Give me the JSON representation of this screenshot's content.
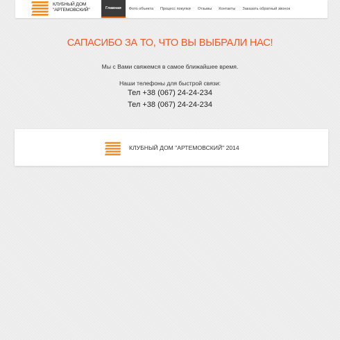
{
  "header": {
    "logo_line1": "КЛУБНЫЙ ДОМ",
    "logo_line2": "\"АРТЕМОВСКИЙ\"",
    "nav": [
      {
        "label": "Главная",
        "active": true
      },
      {
        "label": "Фото объекта",
        "active": false
      },
      {
        "label": "Процесс покупки",
        "active": false
      },
      {
        "label": "Отзывы",
        "active": false
      },
      {
        "label": "Контакты",
        "active": false
      },
      {
        "label": "Заказать обратный звонок",
        "active": false
      }
    ]
  },
  "main": {
    "title": "САПАСИБО ЗА ТО, ЧТО ВЫ ВЫБРАЛИ НАС!",
    "contact_message": "Мы с Вами свяжемся в самое ближайшее время.",
    "phones_label": "Наши телефоны для быстрой связи:",
    "phones": [
      "Тел +38 (067) 24-24-234",
      "Тел +38 (067) 24-24-234"
    ]
  },
  "footer": {
    "text": "КЛУБНЫЙ ДОМ \"АРТЕМОВСКИЙ\" 2014"
  },
  "colors": {
    "accent": "#ef5a2a",
    "logo_orange": "#f0891e",
    "nav_active_bg": "#3a3a3a"
  },
  "icons": {
    "logo": "striped-building-logo-icon"
  }
}
